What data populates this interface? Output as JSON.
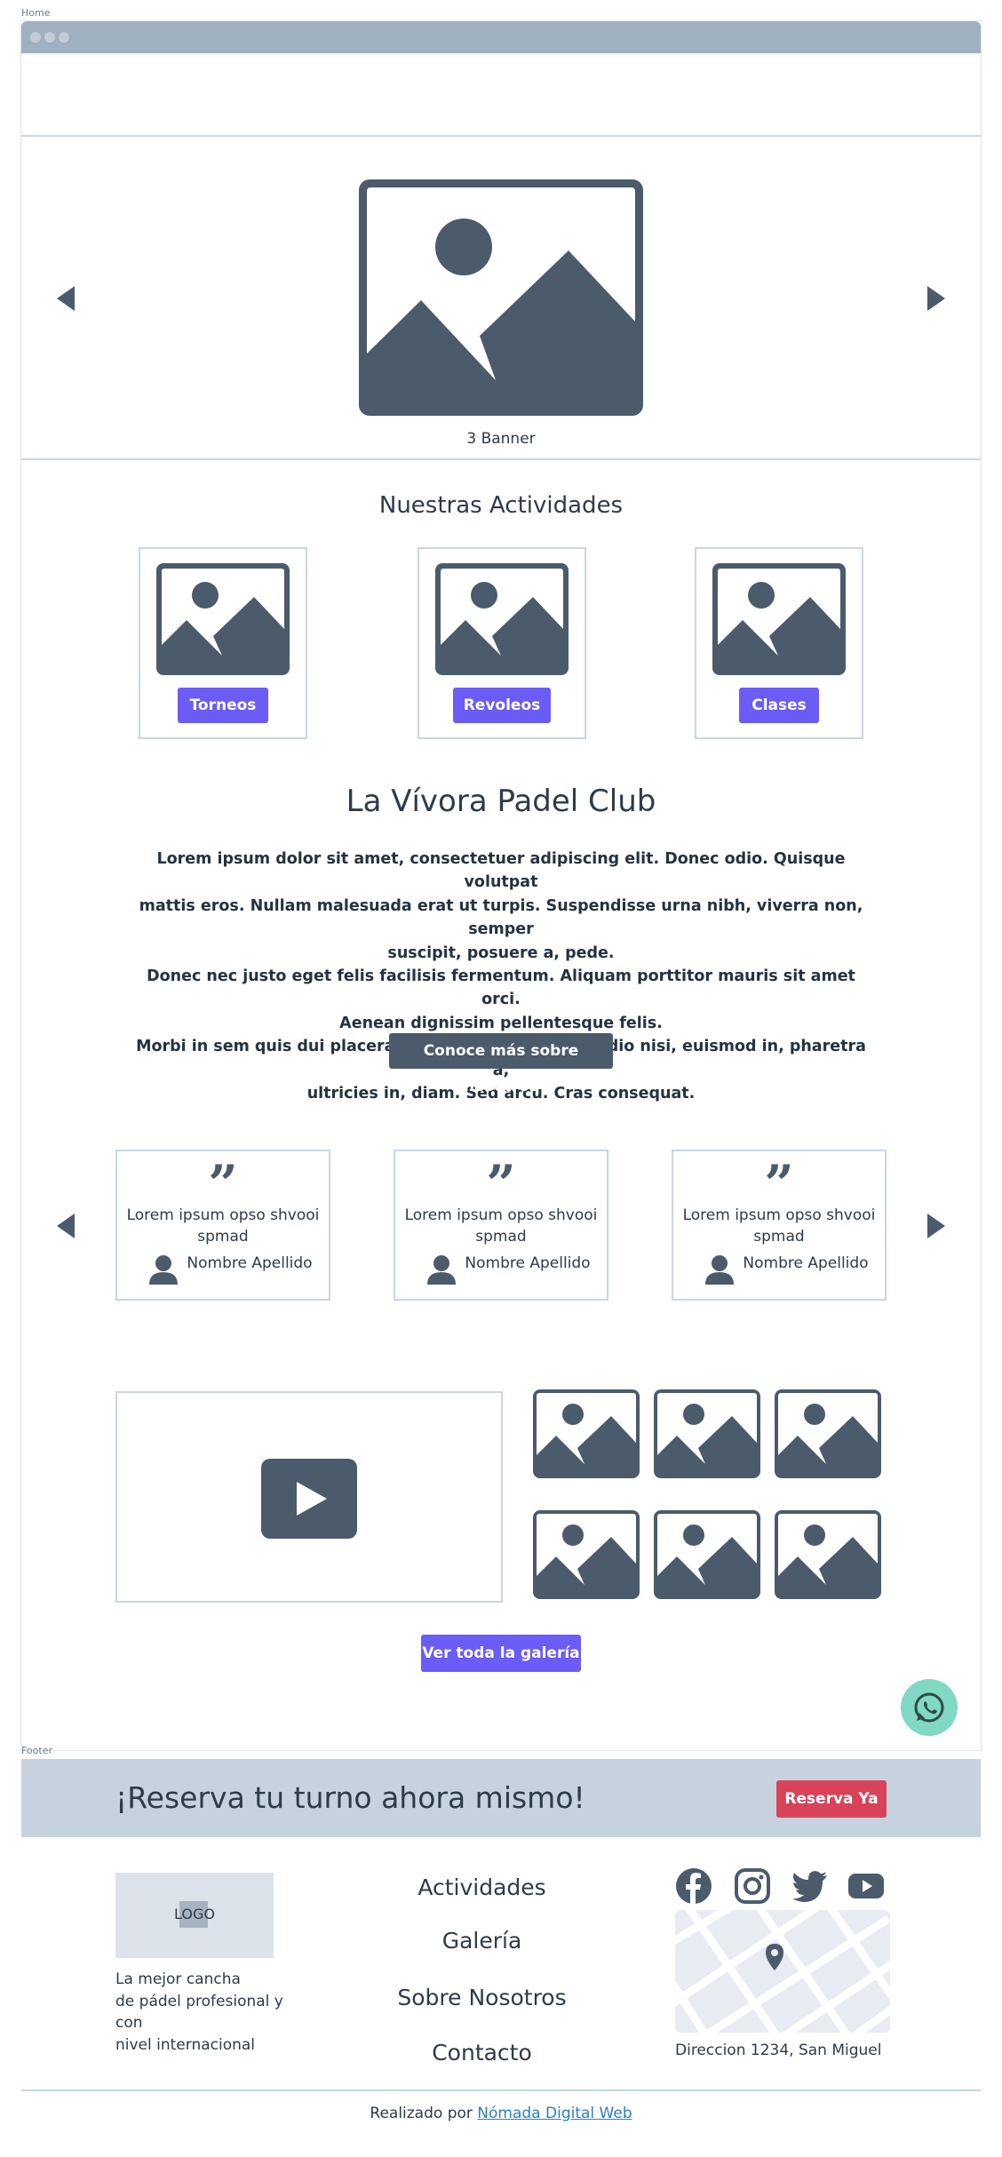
{
  "frames": {
    "home_label": "Home",
    "footer_label": "Footer"
  },
  "banner": {
    "caption": "3 Banner"
  },
  "activities": {
    "title": "Nuestras Actividades",
    "items": [
      {
        "label": "Torneos"
      },
      {
        "label": "Revoleos"
      },
      {
        "label": "Clases"
      }
    ]
  },
  "about": {
    "title": "La Vívora Padel Club",
    "lines": [
      "Lorem ipsum dolor sit amet, consectetuer adipiscing elit. Donec odio. Quisque volutpat",
      "mattis eros. Nullam malesuada erat ut turpis. Suspendisse urna nibh, viverra non, semper",
      "suscipit, posuere a, pede.",
      "Donec nec justo eget felis facilisis fermentum. Aliquam porttitor mauris sit amet orci.",
      "Aenean dignissim pellentesque felis.",
      "Morbi in sem quis dui placerat ornare. Pellentesque odio nisi, euismod in, pharetra a,",
      "ultricies in, diam. Sed arcu. Cras consequat."
    ],
    "button_label": "Conoce más sobre nosotros"
  },
  "testimonials": [
    {
      "quote_mark": "”",
      "text": "Lorem ipsum opso shvooi spmad",
      "author": "Nombre Apellido"
    },
    {
      "quote_mark": "”",
      "text": "Lorem ipsum opso shvooi spmad",
      "author": "Nombre Apellido"
    },
    {
      "quote_mark": "”",
      "text": "Lorem ipsum opso shvooi spmad",
      "author": "Nombre Apellido"
    }
  ],
  "gallery": {
    "button_label": "Ver toda la galería"
  },
  "footer": {
    "cta_text": "¡Reserva tu turno ahora mismo!",
    "cta_button": "Reserva Ya",
    "logo_text": "LOGO",
    "description": [
      "La mejor cancha",
      "de pádel profesional y con",
      "nivel internacional"
    ],
    "links": [
      "Actividades",
      "Galería",
      "Sobre Nosotros",
      "Contacto"
    ],
    "address": "Direccion 1234, San Miguel",
    "credit_prefix": "Realizado por",
    "credit_link": "Nómada Digital Web"
  },
  "colors": {
    "accent_purple": "#6b5cf6",
    "dark_slate": "#4b5b6b",
    "cta_red": "#d84359",
    "whatsapp_green": "#81d8c5",
    "footer_band": "#c6d2dd"
  },
  "icons": [
    "arrow-left-icon",
    "arrow-right-icon",
    "image-placeholder-icon",
    "quote-icon",
    "person-icon",
    "play-icon",
    "whatsapp-icon",
    "facebook-icon",
    "instagram-icon",
    "twitter-icon",
    "youtube-icon",
    "map-pin-icon"
  ]
}
